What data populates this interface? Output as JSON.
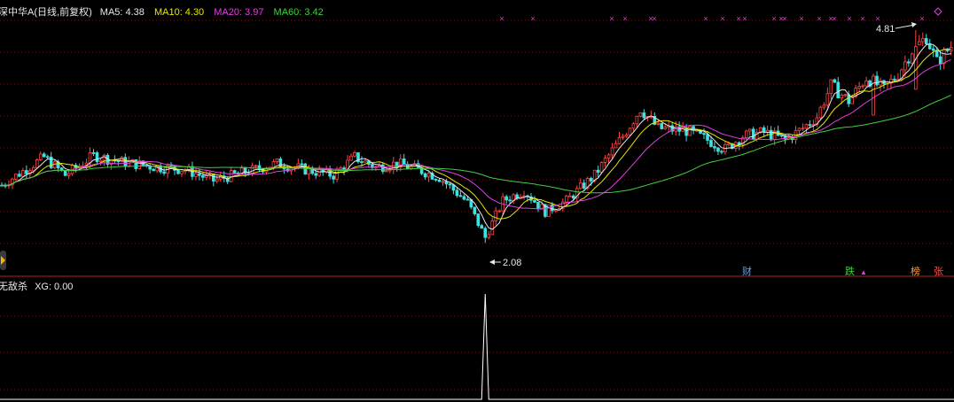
{
  "header": {
    "stock_name": "深中华A",
    "period": "(日线,前复权)",
    "ma5": {
      "label": "MA5:",
      "value": "4.38",
      "color": "#e8e8e8"
    },
    "ma10": {
      "label": "MA10:",
      "value": "4.30",
      "color": "#e8e800"
    },
    "ma20": {
      "label": "MA20:",
      "value": "3.97",
      "color": "#e040e0"
    },
    "ma60": {
      "label": "MA60:",
      "value": "3.42",
      "color": "#40d040"
    }
  },
  "indicator": {
    "name": "无敌杀",
    "label": "XG:",
    "value": "0.00"
  },
  "annotations": {
    "high": "4.81",
    "low": "2.08"
  },
  "events": [
    {
      "text": "财",
      "color": "#4aa8ff"
    },
    {
      "text": "跌",
      "color": "#40d040"
    },
    {
      "text": "▲",
      "color": "#e040e0"
    },
    {
      "text": "榜",
      "color": "#ff9a3c"
    },
    {
      "text": "张",
      "color": "#ff5050"
    }
  ],
  "colors": {
    "up": "#ff4444",
    "down": "#40e0e0",
    "grid": "#7a1010",
    "marker": "#e040e0",
    "indicator_line": "#ffffff"
  },
  "chart_data": {
    "type": "candlestick",
    "price_range": [
      1.72,
      5.15
    ],
    "indicator_range": [
      0,
      1
    ],
    "signal_index": 137
  }
}
